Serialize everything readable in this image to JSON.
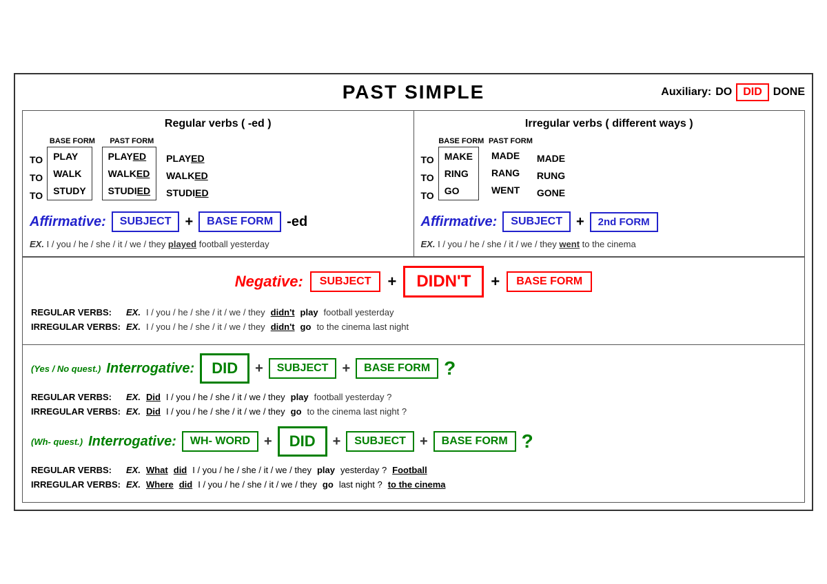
{
  "title": "PAST SIMPLE",
  "auxiliary": {
    "label": "Auxiliary:",
    "do": "DO",
    "did": "DID",
    "done": "DONE"
  },
  "left": {
    "section_title": "Regular verbs  ( -ed )",
    "col_base": "BASE FORM",
    "col_past": "PAST FORM",
    "to_words": [
      "TO",
      "TO",
      "TO"
    ],
    "base_verbs": [
      "PLAY",
      "WALK",
      "STUDY"
    ],
    "past_verbs": [
      "PLAYED",
      "WALKED",
      "STUDIED"
    ],
    "past_verbs2": [
      "PLAYED",
      "WALKED",
      "STUDIED"
    ],
    "affirmative_label": "Affirmative:",
    "subject_box": "SUBJECT",
    "base_form_box": "BASE FORM",
    "ed_suffix": "-ed",
    "ex_label": "EX.",
    "ex_pronouns": "I / you / he / she / it / we / they",
    "ex_verb": "played",
    "ex_rest": "football yesterday"
  },
  "right": {
    "section_title": "Irregular verbs  ( different ways )",
    "col_base": "BASE FORM",
    "col_past": "PAST FORM",
    "to_words": [
      "TO",
      "TO",
      "TO"
    ],
    "base_verbs": [
      "MAKE",
      "RING",
      "GO"
    ],
    "past_verbs": [
      "MADE",
      "RANG",
      "WENT"
    ],
    "past_verbs2": [
      "MADE",
      "RUNG",
      "GONE"
    ],
    "affirmative_label": "Affirmative:",
    "subject_box": "SUBJECT",
    "second_form_box": "2nd FORM",
    "ex_label": "EX.",
    "ex_pronouns": "I / you / he / she / it / we / they",
    "ex_verb": "went",
    "ex_rest": "to the cinema"
  },
  "negative": {
    "label": "Negative:",
    "subject_box": "SUBJECT",
    "didnt_box": "DIDN'T",
    "base_form_box": "BASE FORM",
    "plus": "+",
    "regular": {
      "type": "REGULAR VERBS:",
      "ex_label": "EX.",
      "pronouns": "I / you / he / she / it / we / they",
      "didnt": "didn't",
      "verb": "play",
      "rest": "football yesterday"
    },
    "irregular": {
      "type": "IRREGULAR VERBS:",
      "ex_label": "EX.",
      "pronouns": "I / you / he / she / it / we / they",
      "didnt": "didn't",
      "verb": "go",
      "rest": "to the cinema last night"
    }
  },
  "interrogative_yn": {
    "yes_no_label": "(Yes / No quest.)",
    "label": "Interrogative:",
    "did_box": "DID",
    "subject_box": "SUBJECT",
    "base_form_box": "BASE FORM",
    "question_mark": "?",
    "plus": "+",
    "regular": {
      "type": "REGULAR VERBS:",
      "ex_label": "EX.",
      "did": "Did",
      "pronouns": "I / you / he / she / it / we / they",
      "verb": "play",
      "rest": "football yesterday ?"
    },
    "irregular": {
      "type": "IRREGULAR VERBS:",
      "ex_label": "EX.",
      "did": "Did",
      "pronouns": "I / you / he / she / it / we / they",
      "verb": "go",
      "rest": "to the cinema last night ?"
    }
  },
  "interrogative_wh": {
    "wh_label": "(Wh- quest.)",
    "label": "Interrogative:",
    "wh_word_box": "WH- WORD",
    "did_box": "DID",
    "subject_box": "SUBJECT",
    "base_form_box": "BASE FORM",
    "question_mark": "?",
    "plus": "+",
    "regular": {
      "type": "REGULAR VERBS:",
      "ex_label": "EX.",
      "wh_word": "What",
      "did": "did",
      "pronouns": "I / you / he / she / it / we / they",
      "verb": "play",
      "rest": "yesterday ?",
      "extra": "Football"
    },
    "irregular": {
      "type": "IRREGULAR VERBS:",
      "ex_label": "EX.",
      "wh_word": "Where",
      "did": "did",
      "pronouns": "I / you / he / she / it / we / they",
      "verb": "go",
      "rest": "last night ?",
      "extra": "to the cinema"
    }
  }
}
